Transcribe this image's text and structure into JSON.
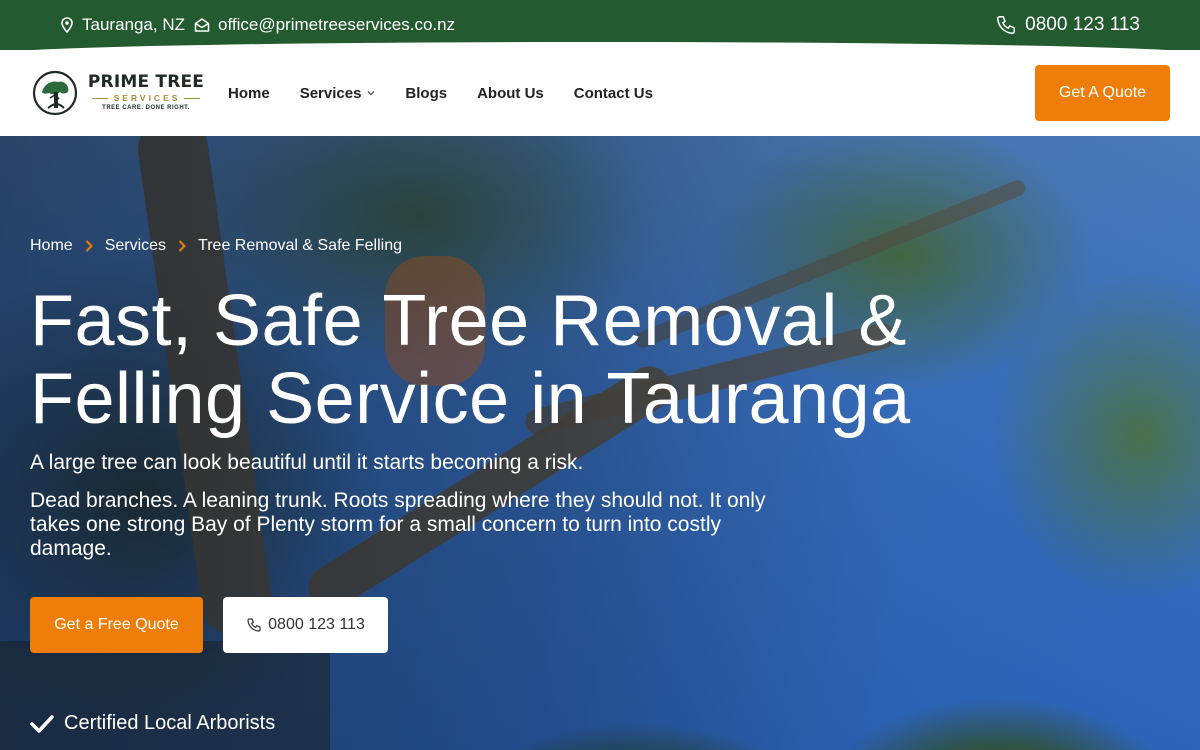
{
  "topbar": {
    "location": "Tauranga, NZ",
    "email": "office@primetreeservices.co.nz",
    "phone": "0800 123 113",
    "icons": [
      "map-pin-icon",
      "envelope-icon",
      "phone-icon"
    ]
  },
  "logo": {
    "title": "PRIME TREE",
    "subtitle": "SERVICES",
    "tagline": "TREE CARE. DONE RIGHT."
  },
  "nav": {
    "items": [
      {
        "label": "Home"
      },
      {
        "label": "Services",
        "has_dropdown": true
      },
      {
        "label": "Blogs"
      },
      {
        "label": "About Us"
      },
      {
        "label": "Contact Us"
      }
    ],
    "cta_label": "Get A Quote"
  },
  "breadcrumb": {
    "items": [
      "Home",
      "Services",
      "Tree Removal & Safe Felling"
    ]
  },
  "hero": {
    "title_line1": "Fast, Safe Tree Removal &",
    "title_line2": "Felling Service in Tauranga",
    "lead": "A large tree can look beautiful until it starts becoming a risk.",
    "description": "Dead branches. A leaning trunk. Roots spreading where they should not. It only takes one strong Bay of Plenty storm for a small concern to turn into costly damage.",
    "primary_button": "Get a Free Quote",
    "phone_button": "0800 123 113",
    "feature": "Certified Local Arborists"
  },
  "colors": {
    "topbar_green": "#245a2f",
    "accent_orange": "#ef7d0a",
    "white": "#ffffff"
  }
}
